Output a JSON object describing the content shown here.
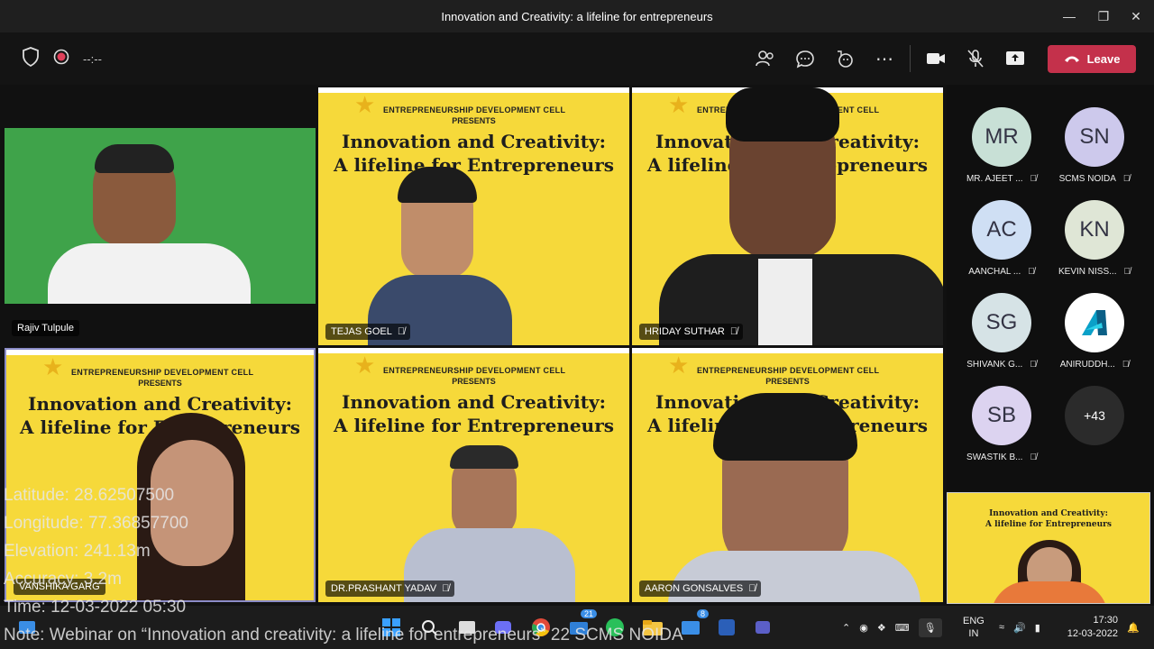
{
  "window": {
    "title": "Innovation and Creativity: a lifeline for entrepreneurs"
  },
  "toolbar": {
    "timer": "--:--",
    "leave_label": "Leave"
  },
  "slide": {
    "cell": "ENTREPRENEURSHIP DEVELOPMENT CELL",
    "presents": "PRESENTS",
    "line1": "Innovation and Creativity:",
    "line2": "A lifeline for Entrepreneurs"
  },
  "tiles": {
    "t1": "Rajiv Tulpule",
    "t2": "TEJAS GOEL",
    "t3": "HRIDAY SUTHAR",
    "t4": "VANSHIKA GARG",
    "t5": "DR.PRASHANT YADAV",
    "t6": "AARON GONSALVES"
  },
  "roster": [
    {
      "initials": "MR",
      "name": "MR. AJEET ..."
    },
    {
      "initials": "SN",
      "name": "SCMS NOIDA"
    },
    {
      "initials": "AC",
      "name": "AANCHAL ..."
    },
    {
      "initials": "KN",
      "name": "KEVIN NISS..."
    },
    {
      "initials": "SG",
      "name": "SHIVANK G..."
    },
    {
      "initials": "",
      "name": "ANIRUDDH..."
    },
    {
      "initials": "SB",
      "name": "SWASTIK B..."
    },
    {
      "initials": "+43",
      "name": ""
    }
  ],
  "overlay": {
    "lat": "Latitude: 28.62507500",
    "lon": "Longitude: 77.36857700",
    "elev": "Elevation: 241.13m",
    "acc": "Accuracy: 3.2m",
    "time": "Time: 12-03-2022  05:30",
    "note": "Note: Webinar on “Innovation and creativity: a lifeline for entrepreneurs” 22 SCMS NOIDA"
  },
  "taskbar": {
    "lang1": "ENG",
    "lang2": "IN",
    "clock": "17:30",
    "date": "12-03-2022",
    "badge1": "21",
    "badge2": "8"
  }
}
